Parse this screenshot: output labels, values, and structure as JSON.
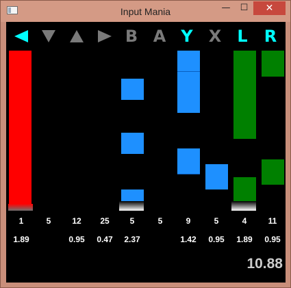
{
  "window": {
    "title": "Input Mania",
    "minimize": "—",
    "maximize": "☐",
    "close": "✕"
  },
  "colors": {
    "active_header": "#00ffff",
    "inactive_header": "#7a7a7a",
    "red": "#ff0000",
    "blue": "#1e90ff",
    "green": "#008000",
    "background": "#000000"
  },
  "columns": [
    {
      "id": "left",
      "label": "left-arrow",
      "icon": "left-arrow-icon",
      "active": true,
      "count": "1",
      "rate": "1.89"
    },
    {
      "id": "down",
      "label": "down-arrow",
      "icon": "down-arrow-icon",
      "active": false,
      "count": "5",
      "rate": ""
    },
    {
      "id": "up",
      "label": "up-arrow",
      "icon": "up-arrow-icon",
      "active": false,
      "count": "12",
      "rate": "0.95"
    },
    {
      "id": "right",
      "label": "right-arrow",
      "icon": "right-arrow-icon",
      "active": false,
      "count": "25",
      "rate": "0.47"
    },
    {
      "id": "b",
      "label": "B",
      "active": false,
      "count": "5",
      "rate": "2.37"
    },
    {
      "id": "a",
      "label": "A",
      "active": false,
      "count": "5",
      "rate": ""
    },
    {
      "id": "y",
      "label": "Y",
      "active": true,
      "count": "9",
      "rate": "1.42"
    },
    {
      "id": "x",
      "label": "X",
      "active": false,
      "count": "5",
      "rate": "0.95"
    },
    {
      "id": "l",
      "label": "L",
      "active": true,
      "count": "4",
      "rate": "1.89"
    },
    {
      "id": "r",
      "label": "R",
      "active": true,
      "count": "11",
      "rate": "0.95"
    }
  ],
  "total": "10.88"
}
